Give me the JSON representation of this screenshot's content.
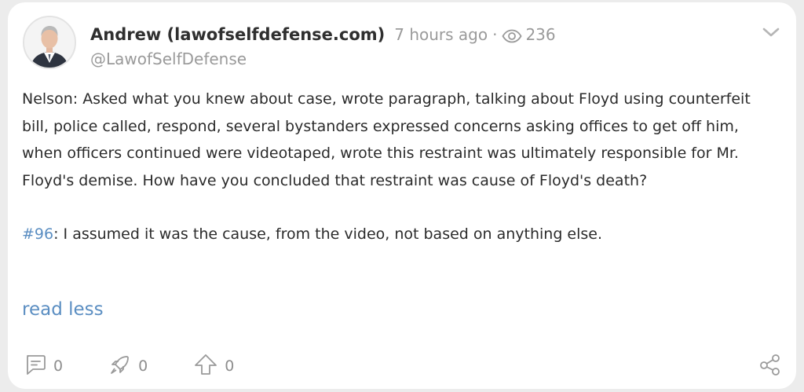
{
  "post": {
    "author_name": "Andrew (lawofselfdefense.com)",
    "time_ago": "7 hours ago",
    "separator": "·",
    "views": "236",
    "handle": "@LawofSelfDefense",
    "paragraph1": "Nelson: Asked what you knew about case, wrote paragraph, talking about Floyd using counterfeit bill, police called, respond, several bystanders expressed concerns asking offices to get off him, when officers continued were videotaped, wrote this restraint was ultimately responsible for Mr. Floyd's demise. How have you concluded that restraint was cause of Floyd's death?",
    "tag": "#96",
    "paragraph2_rest": ": I assumed it was the cause, from the video, not based on anything else.",
    "read_less_label": "read less"
  },
  "actions": {
    "comments_count": "0",
    "boosts_count": "0",
    "upvotes_count": "0"
  },
  "icons": {
    "views": "eye-icon",
    "menu": "chevron-down-icon",
    "comment": "comment-icon",
    "boost": "rocket-icon",
    "upvote": "arrow-up-icon",
    "share": "share-icon"
  },
  "colors": {
    "link": "#5b8ec2",
    "muted": "#9a9a9a",
    "text": "#2b2b2b",
    "background": "#ececec",
    "card": "#ffffff"
  }
}
